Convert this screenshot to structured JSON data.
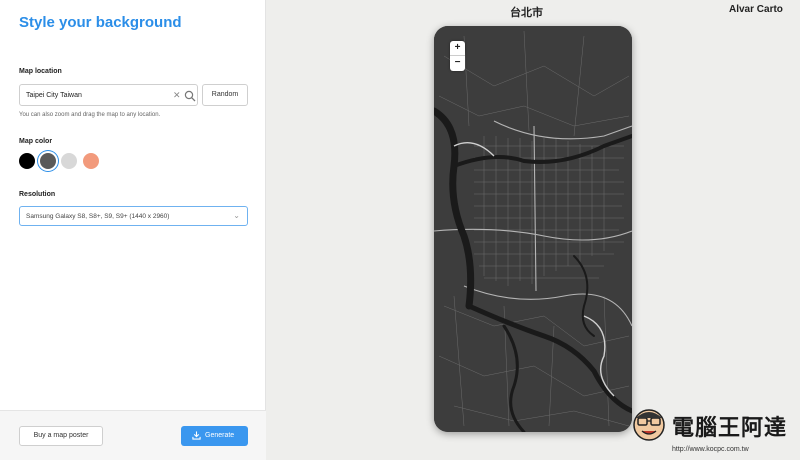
{
  "sidebar": {
    "title": "Style your background",
    "location": {
      "label": "Map location",
      "value": "Taipei City Taiwan",
      "random_label": "Random",
      "hint": "You can also zoom and drag the map to any location."
    },
    "map_color": {
      "label": "Map color",
      "swatches": [
        "#000000",
        "#5a5a5a",
        "#d8d8d8",
        "#f29a7c"
      ],
      "selected_index": 1
    },
    "resolution": {
      "label": "Resolution",
      "value": "Samsung Galaxy S8, S8+, S9, S9+ (1440 x 2960)"
    },
    "footer": {
      "poster_label": "Buy a map poster",
      "generate_label": "Generate"
    }
  },
  "preview": {
    "city": "台北市",
    "brand": "Alvar Carto",
    "zoom_in": "+",
    "zoom_out": "−"
  },
  "watermark": {
    "text": "電腦王阿達",
    "url": "http://www.kocpc.com.tw"
  }
}
